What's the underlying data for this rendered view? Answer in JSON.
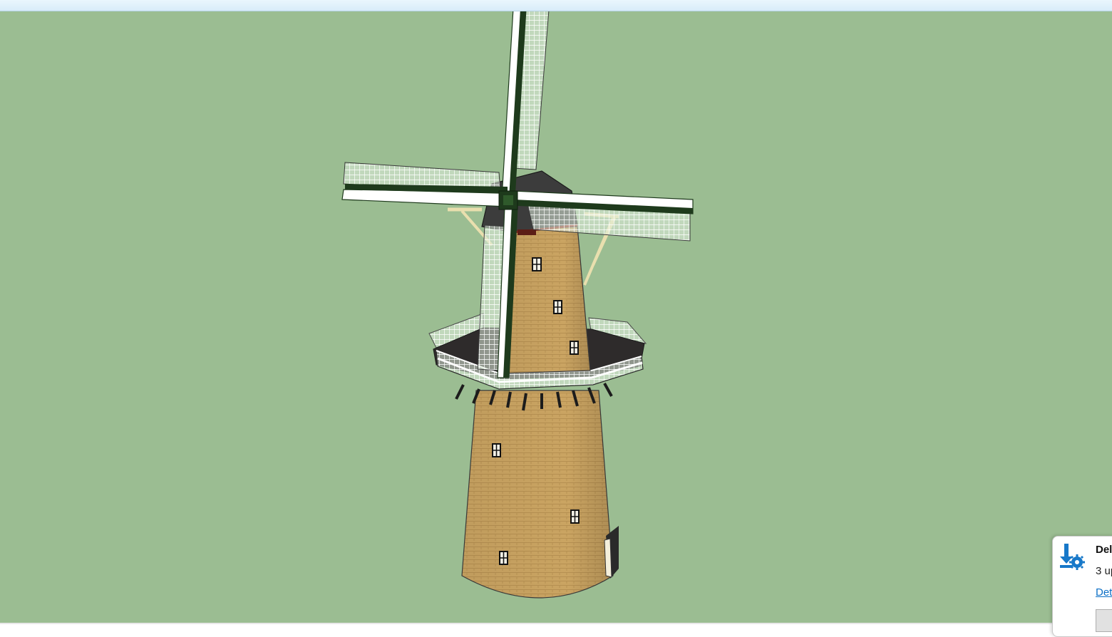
{
  "viewport": {
    "background": "#9bbd92",
    "model": "windmill"
  },
  "notification": {
    "icon": "download-settings-icon",
    "title": "Del",
    "body": "3 up",
    "link": "Det"
  },
  "colors": {
    "brick": "#c8a260",
    "brick_dark": "#a47f44",
    "cap": "#3a3a3a",
    "sail_lattice": "#eef6ea",
    "sail_spar": "#ffffff",
    "sail_dark": "#1e3a1c",
    "link": "#0b6fc6"
  }
}
